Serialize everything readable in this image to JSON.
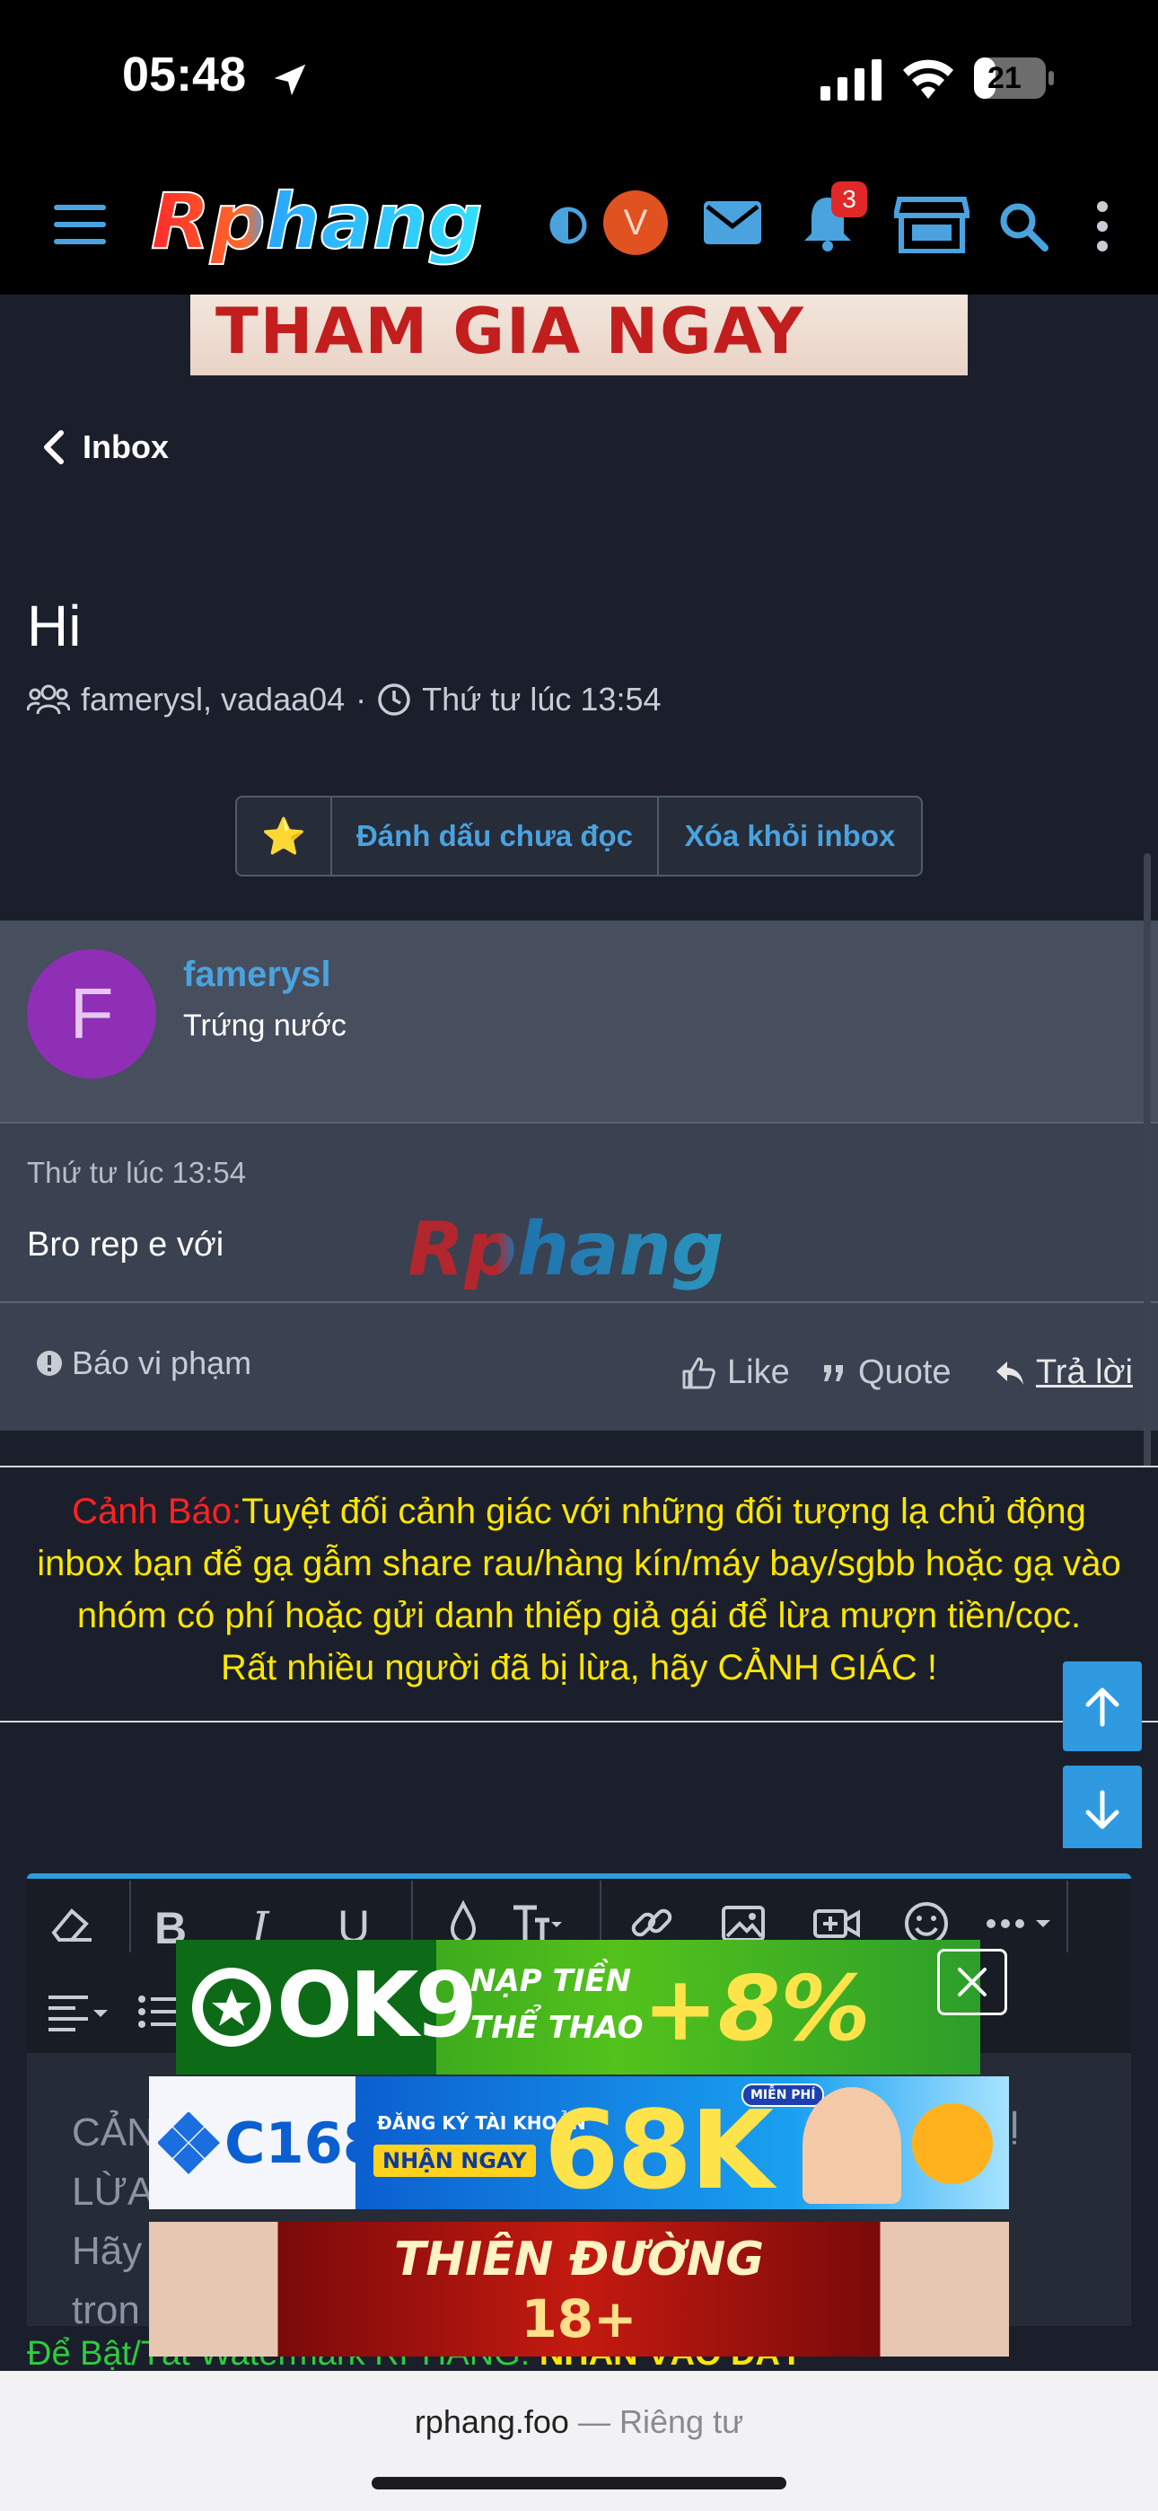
{
  "status_bar": {
    "time": "05:48",
    "battery": "21"
  },
  "nav": {
    "logo_text": "Rphang",
    "avatar_letter": "V",
    "notification_count": "3"
  },
  "ad_top": {
    "text": "THAM GIA NGAY"
  },
  "back": {
    "label": "Inbox"
  },
  "conversation": {
    "title": "Hi",
    "participants": "famerysl, vadaa04",
    "separator": "·",
    "time": "Thứ tư lúc 13:54"
  },
  "actions": {
    "star": "⭐",
    "mark_unread": "Đánh dấu chưa đọc",
    "remove": "Xóa khỏi inbox"
  },
  "message": {
    "avatar_letter": "F",
    "username": "famerysl",
    "user_title": "Trứng nước",
    "date": "Thứ tư lúc 13:54",
    "body": "Bro rep e với",
    "watermark": "Rphang",
    "report": "Báo vi phạm",
    "like": "Like",
    "quote": "Quote",
    "reply": "Trả lời"
  },
  "warning": {
    "label": "Cảnh Báo:",
    "line1": "Tuyệt đối cảnh giác với những đối tượng lạ chủ động",
    "line2": "inbox bạn để gạ gẫm share rau/hàng kín/máy bay/sgbb hoặc gạ vào",
    "line3": "nhóm có phí hoặc gửi danh thiếp giả gái để lừa mượn tiền/cọc.",
    "line4": "Rất nhiều người đã bị lừa, hãy CẢNH GIÁC !"
  },
  "editor": {
    "line1": "CẢN",
    "line1_end": "Ị",
    "line2": "LỪA",
    "line3": "Hãy",
    "line4": "tron",
    "toggle_prefix": "Để Bật/Tắt Watermark RPHANG:",
    "toggle_action": "NHẤN VÀO ĐÂY"
  },
  "ads": {
    "ok9": {
      "brand": "OK9",
      "line1": "NẠP TIỀN",
      "line2": "THỂ THAO",
      "promo": "+8%"
    },
    "c168": {
      "brand": "C168",
      "line1": "ĐĂNG KÝ TÀI KHOẢN",
      "line2": "NHẬN NGAY",
      "promo": "68K",
      "tag": "MIỄN PHÍ"
    },
    "eighteen": {
      "line1": "THIÊN ĐƯỜNG",
      "line2": "18+"
    }
  },
  "browser": {
    "domain": "rphang.foo",
    "separator": "—",
    "privacy": "Riêng tư"
  }
}
